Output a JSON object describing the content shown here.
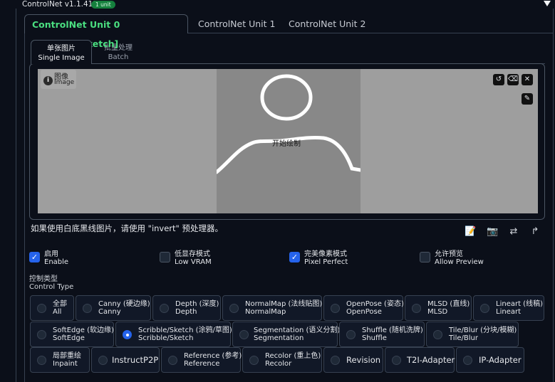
{
  "header": {
    "title": "ControlNet v1.1.411",
    "badge": "1 unit"
  },
  "unit_tabs": [
    {
      "label": "ControlNet Unit 0 [Scribble/Sketch]",
      "active": true
    },
    {
      "label": "ControlNet Unit 1",
      "active": false
    },
    {
      "label": "ControlNet Unit 2",
      "active": false
    }
  ],
  "image_tabs": [
    {
      "zh": "单张图片",
      "en": "Single Image",
      "active": true
    },
    {
      "zh": "批量处理",
      "en": "Batch",
      "active": false
    }
  ],
  "canvas": {
    "label_zh": "图像",
    "label_en": "Image",
    "start_draw": "开始绘制"
  },
  "hint": "如果使用白底黑线图片，请使用 \"invert\" 预处理器。",
  "options": [
    {
      "zh": "启用",
      "en": "Enable",
      "checked": true
    },
    {
      "zh": "低显存模式",
      "en": "Low VRAM",
      "checked": false
    },
    {
      "zh": "完美像素模式",
      "en": "Pixel Perfect",
      "checked": true
    },
    {
      "zh": "允许预览",
      "en": "Allow Preview",
      "checked": false
    }
  ],
  "control_type": {
    "label_zh": "控制类型",
    "label_en": "Control Type",
    "items": [
      {
        "zh": "全部",
        "en": "All",
        "selected": false
      },
      {
        "zh": "Canny (硬边缘)",
        "en": "Canny",
        "selected": false
      },
      {
        "zh": "Depth (深度)",
        "en": "Depth",
        "selected": false
      },
      {
        "zh": "NormalMap (法线贴图)",
        "en": "NormalMap",
        "selected": false
      },
      {
        "zh": "OpenPose (姿态)",
        "en": "OpenPose",
        "selected": false
      },
      {
        "zh": "MLSD (直线)",
        "en": "MLSD",
        "selected": false
      },
      {
        "zh": "Lineart (线稿)",
        "en": "Lineart",
        "selected": false
      },
      {
        "zh": "SoftEdge (软边缘)",
        "en": "SoftEdge",
        "selected": false
      },
      {
        "zh": "Scribble/Sketch (涂鸦/草图)",
        "en": "Scribble/Sketch",
        "selected": true
      },
      {
        "zh": "Segmentation (语义分割)",
        "en": "Segmentation",
        "selected": false
      },
      {
        "zh": "Shuffle (随机洗牌)",
        "en": "Shuffle",
        "selected": false
      },
      {
        "zh": "Tile/Blur (分块/模糊)",
        "en": "Tile/Blur",
        "selected": false
      },
      {
        "zh": "局部重绘",
        "en": "Inpaint",
        "selected": false
      },
      {
        "single": "InstructP2P",
        "selected": false
      },
      {
        "zh": "Reference (参考)",
        "en": "Reference",
        "selected": false
      },
      {
        "zh": "Recolor (重上色)",
        "en": "Recolor",
        "selected": false
      },
      {
        "single": "Revision",
        "selected": false
      },
      {
        "single": "T2I-Adapter",
        "selected": false
      },
      {
        "single": "IP-Adapter",
        "selected": false
      }
    ]
  },
  "icons": [
    "collapse-triangle-icon",
    "info-icon",
    "undo-icon",
    "eraser-icon",
    "close-icon",
    "brush-icon",
    "notepad-icon",
    "camera-icon",
    "swap-icon",
    "upload-arrow-icon"
  ],
  "colors": {
    "accent_green": "#4ade80",
    "badge_green": "#15803d",
    "accent_blue": "#2563eb",
    "background": "#0b0f19"
  }
}
